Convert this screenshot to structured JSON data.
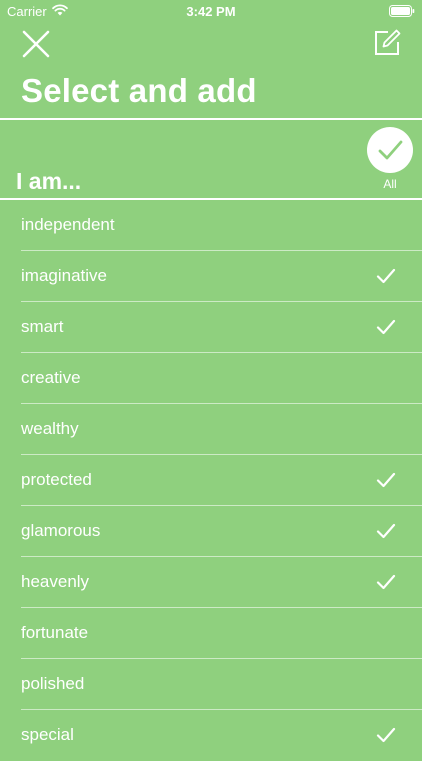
{
  "status_bar": {
    "carrier": "Carrier",
    "time": "3:42 PM"
  },
  "header": {
    "close_icon": "close-icon",
    "edit_icon": "compose-icon",
    "title": "Select and add"
  },
  "section": {
    "title": "I am...",
    "select_all_label": "All",
    "select_all_icon": "checkmark-icon"
  },
  "colors": {
    "background": "#8fd07e",
    "foreground": "#ffffff"
  },
  "items": [
    {
      "label": "independent",
      "checked": false
    },
    {
      "label": "imaginative",
      "checked": true
    },
    {
      "label": "smart",
      "checked": true
    },
    {
      "label": "creative",
      "checked": false
    },
    {
      "label": "wealthy",
      "checked": false
    },
    {
      "label": "protected",
      "checked": true
    },
    {
      "label": "glamorous",
      "checked": true
    },
    {
      "label": "heavenly",
      "checked": true
    },
    {
      "label": "fortunate",
      "checked": false
    },
    {
      "label": "polished",
      "checked": false
    },
    {
      "label": "special",
      "checked": true
    }
  ]
}
